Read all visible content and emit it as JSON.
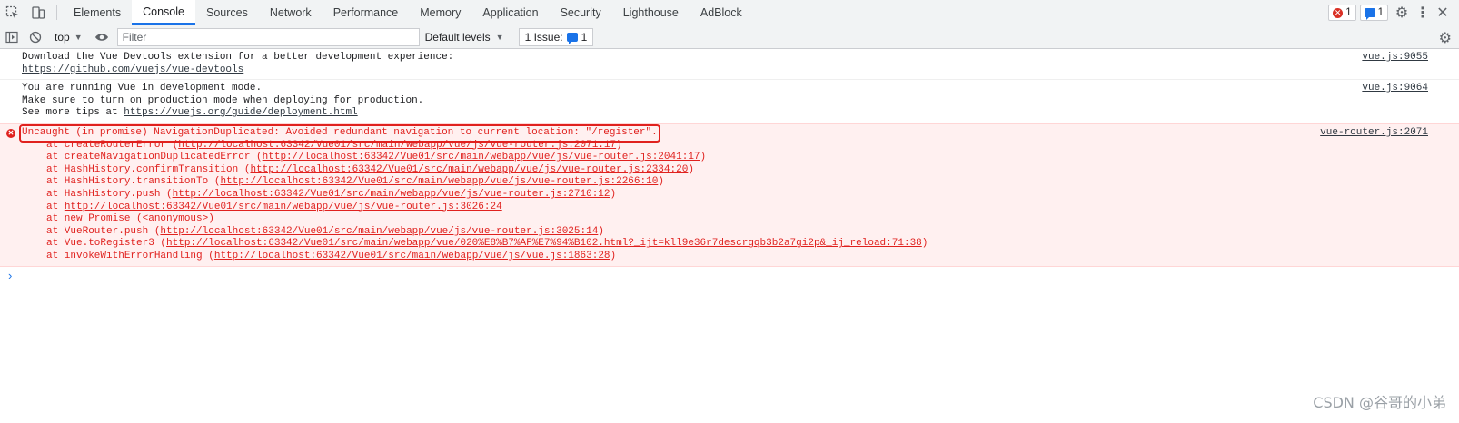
{
  "tabbar": {
    "tabs": [
      "Elements",
      "Console",
      "Sources",
      "Network",
      "Performance",
      "Memory",
      "Application",
      "Security",
      "Lighthouse",
      "AdBlock"
    ],
    "active_tab": "Console",
    "error_count": "1",
    "message_count": "1"
  },
  "toolbar": {
    "context": "top",
    "filter_placeholder": "Filter",
    "levels": "Default levels",
    "issues_label": "1 Issue:",
    "issues_count": "1"
  },
  "console": {
    "entries": [
      {
        "level": "info",
        "lines": [
          "Download the Vue Devtools extension for a better development experience:"
        ],
        "link": "https://github.com/vuejs/vue-devtools",
        "source": "vue.js:9055"
      },
      {
        "level": "info",
        "lines": [
          "You are running Vue in development mode.",
          "Make sure to turn on production mode when deploying for production."
        ],
        "tip_prefix": "See more tips at ",
        "link": "https://vuejs.org/guide/deployment.html",
        "source": "vue.js:9064"
      }
    ],
    "error": {
      "message": "Uncaught (in promise) NavigationDuplicated: Avoided redundant navigation to current location: \"/register\".",
      "source": "vue-router.js:2071",
      "stack": [
        {
          "pre": "at createRouterError (",
          "link": "http://localhost:63342/Vue01/src/main/webapp/vue/js/vue-router.js:2071:17",
          "post": ")"
        },
        {
          "pre": "at createNavigationDuplicatedError (",
          "link": "http://localhost:63342/Vue01/src/main/webapp/vue/js/vue-router.js:2041:17",
          "post": ")"
        },
        {
          "pre": "at HashHistory.confirmTransition (",
          "link": "http://localhost:63342/Vue01/src/main/webapp/vue/js/vue-router.js:2334:20",
          "post": ")"
        },
        {
          "pre": "at HashHistory.transitionTo (",
          "link": "http://localhost:63342/Vue01/src/main/webapp/vue/js/vue-router.js:2266:10",
          "post": ")"
        },
        {
          "pre": "at HashHistory.push (",
          "link": "http://localhost:63342/Vue01/src/main/webapp/vue/js/vue-router.js:2710:12",
          "post": ")"
        },
        {
          "pre": "at ",
          "link": "http://localhost:63342/Vue01/src/main/webapp/vue/js/vue-router.js:3026:24",
          "post": ""
        },
        {
          "pre": "at new Promise (<anonymous>)",
          "link": "",
          "post": ""
        },
        {
          "pre": "at VueRouter.push (",
          "link": "http://localhost:63342/Vue01/src/main/webapp/vue/js/vue-router.js:3025:14",
          "post": ")"
        },
        {
          "pre": "at Vue.toRegister3 (",
          "link": "http://localhost:63342/Vue01/src/main/webapp/vue/020%E8%B7%AF%E7%94%B102.html?_ijt=kll9e36r7descrgqb3b2a7gi2p&_ij_reload:71:38",
          "post": ")"
        },
        {
          "pre": "at invokeWithErrorHandling (",
          "link": "http://localhost:63342/Vue01/src/main/webapp/vue/js/vue.js:1863:28",
          "post": ")"
        }
      ]
    },
    "prompt": "›"
  },
  "watermark": "CSDN @谷哥的小弟",
  "colors": {
    "accent": "#1a73e8",
    "error": "#e0211e",
    "error_bg": "#fff0f0"
  }
}
